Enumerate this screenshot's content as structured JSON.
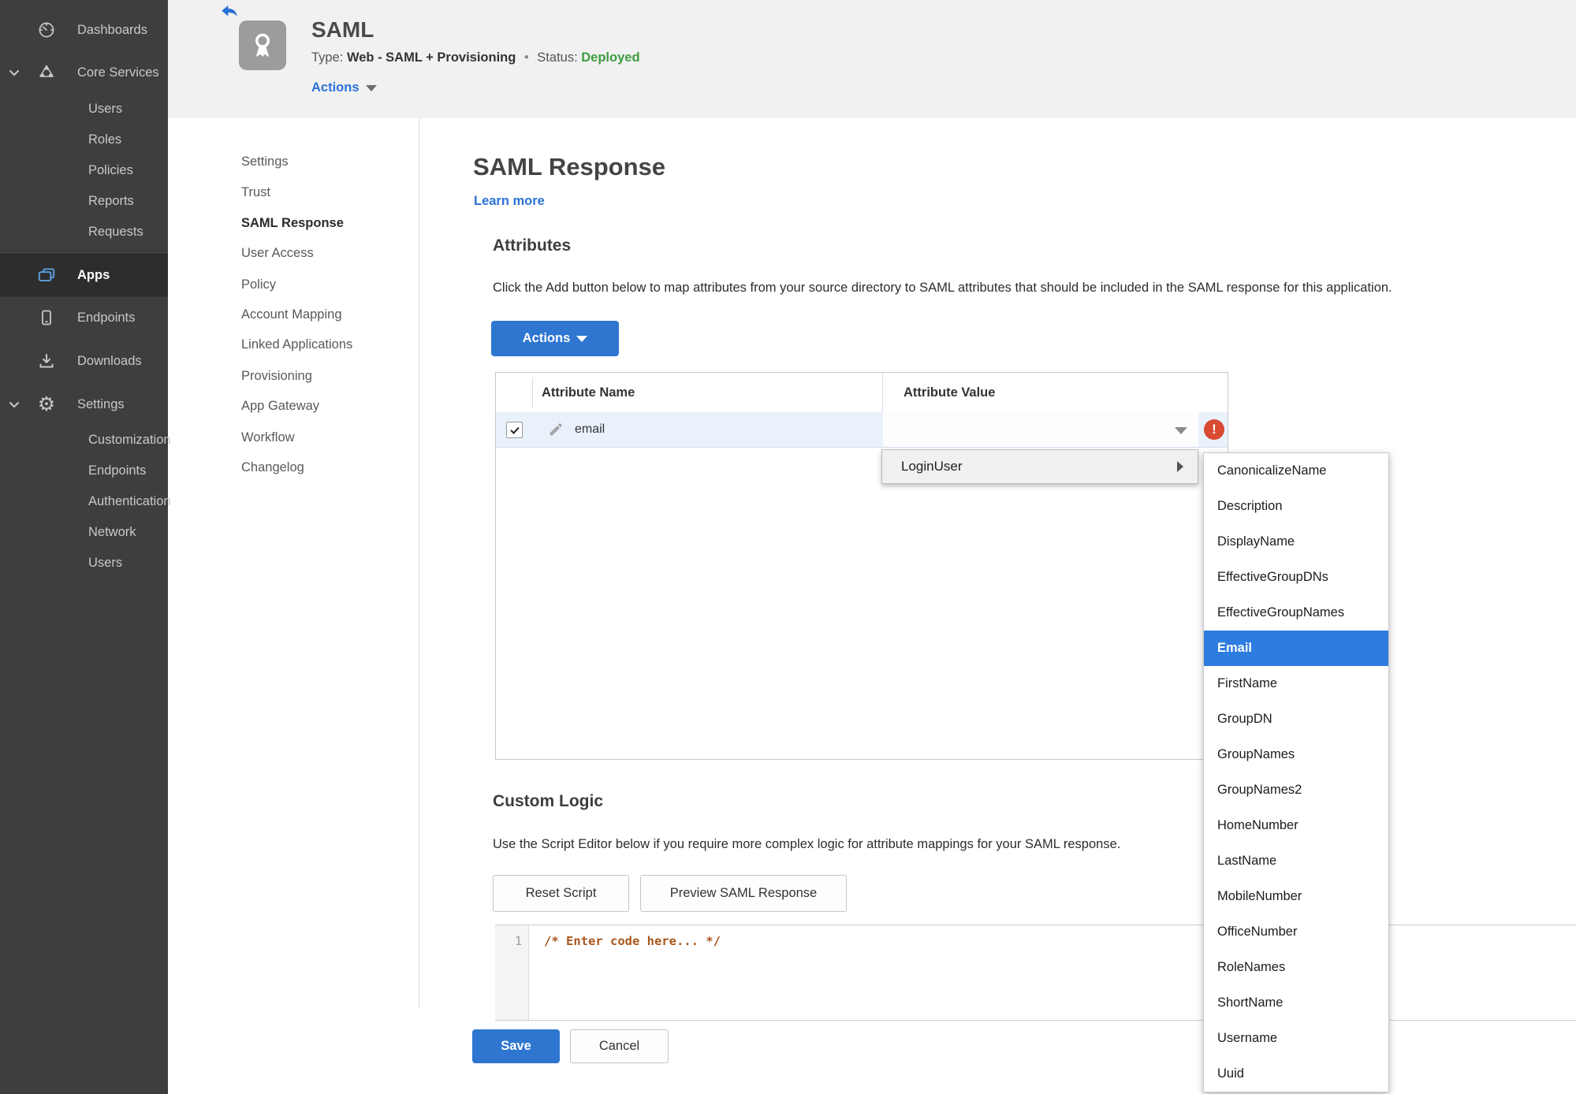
{
  "icons": {
    "gear_glyph": "⚙",
    "error_glyph": "!"
  },
  "colors": {
    "accent_blue": "#2e76d0",
    "selected_blue": "#2e7ce0",
    "link_blue": "#2b72d7",
    "status_green": "#3e9c3e",
    "error_red": "#d84a32",
    "sidebar_bg": "#3e3e3f",
    "header_bg": "#f1f1f2",
    "row_highlight": "#e9f1fb"
  },
  "sidebar": {
    "dashboards": "Dashboards",
    "core_services": "Core Services",
    "core_children": [
      "Users",
      "Roles",
      "Policies",
      "Reports",
      "Requests"
    ],
    "apps": "Apps",
    "endpoints": "Endpoints",
    "downloads": "Downloads",
    "settings": "Settings",
    "settings_children": [
      "Customization",
      "Endpoints",
      "Authentication",
      "Network",
      "Users"
    ]
  },
  "header": {
    "title": "SAML",
    "type_label": "Type:",
    "type_value": "Web - SAML + Provisioning",
    "separator": "•",
    "status_label": "Status:",
    "status_value": "Deployed",
    "actions_label": "Actions"
  },
  "subnav": [
    "Settings",
    "Trust",
    "SAML Response",
    "User Access",
    "Policy",
    "Account Mapping",
    "Linked Applications",
    "Provisioning",
    "App Gateway",
    "Workflow",
    "Changelog"
  ],
  "main": {
    "title": "SAML Response",
    "learn_more": "Learn more",
    "attributes_heading": "Attributes",
    "attributes_description": "Click the Add button below to map attributes from your source directory to SAML attributes that should be included in the SAML response for this application.",
    "actions_button": "Actions",
    "table": {
      "col_name": "Attribute Name",
      "col_value": "Attribute Value",
      "row_name": "email",
      "row_value": ""
    },
    "custom_logic_heading": "Custom Logic",
    "custom_logic_description": "Use the Script Editor below if you require more complex logic for attribute mappings for your SAML response.",
    "reset_button": "Reset Script",
    "preview_button": "Preview SAML Response",
    "editor_line_number": "1",
    "editor_code": "/* Enter code here... */",
    "save_button": "Save",
    "cancel_button": "Cancel"
  },
  "value_menu": {
    "parent_item": "LoginUser",
    "selected_item": "Email",
    "items": [
      "CanonicalizeName",
      "Description",
      "DisplayName",
      "EffectiveGroupDNs",
      "EffectiveGroupNames",
      "Email",
      "FirstName",
      "GroupDN",
      "GroupNames",
      "GroupNames2",
      "HomeNumber",
      "LastName",
      "MobileNumber",
      "OfficeNumber",
      "RoleNames",
      "ShortName",
      "Username",
      "Uuid"
    ]
  }
}
